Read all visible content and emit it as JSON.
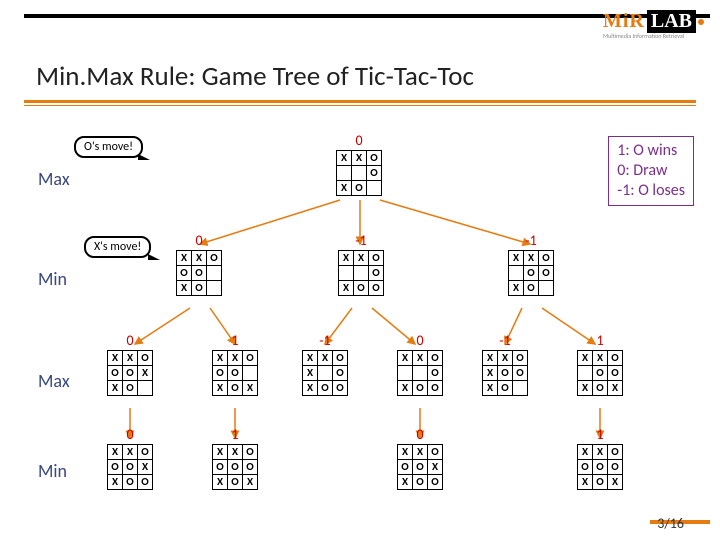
{
  "title": "Min.Max Rule: Game Tree of Tic-Tac-Toc",
  "logo": {
    "brand1": "MiR",
    "brand2": "LAB",
    "sub": "Multimedia Information Retrieval"
  },
  "callouts": {
    "c0": "O's move!",
    "c1": "X's move!"
  },
  "layers": {
    "l0": "Max",
    "l1": "Min",
    "l2": "Max",
    "l3": "Min"
  },
  "legend": {
    "line1": "1: O wins",
    "line2": "0: Draw",
    "line3": "-1: O loses"
  },
  "page": {
    "current": "3",
    "total": "16"
  },
  "root": {
    "score": "0",
    "cells": [
      "X",
      "X",
      "O",
      "",
      "",
      "O",
      "X",
      "O",
      ""
    ]
  },
  "d1": [
    {
      "score": "0",
      "cells": [
        "X",
        "X",
        "O",
        "O",
        "O",
        "",
        "X",
        "O",
        ""
      ]
    },
    {
      "score": "-1",
      "cells": [
        "X",
        "X",
        "O",
        "",
        "",
        "O",
        "X",
        "O",
        "O"
      ]
    },
    {
      "score": "-1",
      "cells": [
        "X",
        "X",
        "O",
        "",
        "O",
        "O",
        "X",
        "O",
        ""
      ]
    }
  ],
  "d2": [
    {
      "score": "0",
      "cells": [
        "X",
        "X",
        "O",
        "O",
        "O",
        "X",
        "X",
        "O",
        ""
      ]
    },
    {
      "score": "1",
      "cells": [
        "X",
        "X",
        "O",
        "O",
        "O",
        "",
        "X",
        "O",
        "X"
      ]
    },
    {
      "score": "-1",
      "cells": [
        "X",
        "X",
        "O",
        "X",
        "",
        "O",
        "X",
        "O",
        "O"
      ]
    },
    {
      "score": "0",
      "cells": [
        "X",
        "X",
        "O",
        "",
        "",
        "O",
        "X",
        "O",
        "O"
      ]
    },
    {
      "score": "-1",
      "cells": [
        "X",
        "X",
        "O",
        "X",
        "O",
        "O",
        "X",
        "O",
        ""
      ]
    },
    {
      "score": "1",
      "cells": [
        "X",
        "X",
        "O",
        "",
        "O",
        "O",
        "X",
        "O",
        "X"
      ]
    }
  ],
  "d3": [
    {
      "score": "0",
      "cells": [
        "X",
        "X",
        "O",
        "O",
        "O",
        "X",
        "X",
        "O",
        "O"
      ]
    },
    {
      "score": "1",
      "cells": [
        "X",
        "X",
        "O",
        "O",
        "O",
        "O",
        "X",
        "O",
        "X"
      ]
    },
    {
      "score": "0",
      "cells": [
        "X",
        "X",
        "O",
        "O",
        "O",
        "X",
        "X",
        "O",
        "O"
      ]
    },
    {
      "score": "1",
      "cells": [
        "X",
        "X",
        "O",
        "O",
        "O",
        "O",
        "X",
        "O",
        "X"
      ]
    }
  ],
  "chart_data": {
    "type": "tree",
    "title": "Min.Max Rule: Game Tree of Tic-Tac-Toc",
    "layers": [
      "Max",
      "Min",
      "Max",
      "Min"
    ],
    "legend": {
      "1": "O wins",
      "0": "Draw",
      "-1": "O loses"
    },
    "nodes": [
      {
        "id": "r",
        "depth": 0,
        "player": "Max",
        "score": 0,
        "board": [
          "X",
          "X",
          "O",
          "",
          "",
          "O",
          "X",
          "O",
          ""
        ]
      },
      {
        "id": "a",
        "depth": 1,
        "player": "Min",
        "score": 0,
        "parent": "r",
        "move_by": "O",
        "board": [
          "X",
          "X",
          "O",
          "O",
          "O",
          "",
          "X",
          "O",
          ""
        ]
      },
      {
        "id": "b",
        "depth": 1,
        "player": "Min",
        "score": -1,
        "parent": "r",
        "move_by": "O",
        "board": [
          "X",
          "X",
          "O",
          "",
          "",
          "O",
          "X",
          "O",
          "O"
        ]
      },
      {
        "id": "c",
        "depth": 1,
        "player": "Min",
        "score": -1,
        "parent": "r",
        "move_by": "O",
        "board": [
          "X",
          "X",
          "O",
          "",
          "O",
          "O",
          "X",
          "O",
          ""
        ]
      },
      {
        "id": "a1",
        "depth": 2,
        "player": "Max",
        "score": 0,
        "parent": "a",
        "move_by": "X",
        "board": [
          "X",
          "X",
          "O",
          "O",
          "O",
          "X",
          "X",
          "O",
          ""
        ]
      },
      {
        "id": "a2",
        "depth": 2,
        "player": "Max",
        "score": 1,
        "parent": "a",
        "move_by": "X",
        "board": [
          "X",
          "X",
          "O",
          "O",
          "O",
          "",
          "X",
          "O",
          "X"
        ]
      },
      {
        "id": "b1",
        "depth": 2,
        "player": "Max",
        "score": -1,
        "parent": "b",
        "move_by": "X",
        "board": [
          "X",
          "X",
          "O",
          "X",
          "",
          "O",
          "X",
          "O",
          "O"
        ]
      },
      {
        "id": "b2",
        "depth": 2,
        "player": "Max",
        "score": 0,
        "parent": "b",
        "move_by": "X",
        "board": [
          "X",
          "X",
          "O",
          "",
          "",
          "O",
          "X",
          "O",
          "O"
        ]
      },
      {
        "id": "c1",
        "depth": 2,
        "player": "Max",
        "score": -1,
        "parent": "c",
        "move_by": "X",
        "board": [
          "X",
          "X",
          "O",
          "X",
          "O",
          "O",
          "X",
          "O",
          ""
        ]
      },
      {
        "id": "c2",
        "depth": 2,
        "player": "Max",
        "score": 1,
        "parent": "c",
        "move_by": "X",
        "board": [
          "X",
          "X",
          "O",
          "",
          "O",
          "O",
          "X",
          "O",
          "X"
        ]
      },
      {
        "id": "a1o",
        "depth": 3,
        "player": "Min",
        "score": 0,
        "parent": "a1",
        "move_by": "O",
        "board": [
          "X",
          "X",
          "O",
          "O",
          "O",
          "X",
          "X",
          "O",
          "O"
        ]
      },
      {
        "id": "a2o",
        "depth": 3,
        "player": "Min",
        "score": 1,
        "parent": "a2",
        "move_by": "O",
        "board": [
          "X",
          "X",
          "O",
          "O",
          "O",
          "O",
          "X",
          "O",
          "X"
        ]
      },
      {
        "id": "b2o",
        "depth": 3,
        "player": "Min",
        "score": 0,
        "parent": "b2",
        "move_by": "O",
        "board": [
          "X",
          "X",
          "O",
          "O",
          "O",
          "X",
          "X",
          "O",
          "O"
        ]
      },
      {
        "id": "c2o",
        "depth": 3,
        "player": "Min",
        "score": 1,
        "parent": "c2",
        "move_by": "O",
        "board": [
          "X",
          "X",
          "O",
          "O",
          "O",
          "O",
          "X",
          "O",
          "X"
        ]
      }
    ]
  }
}
